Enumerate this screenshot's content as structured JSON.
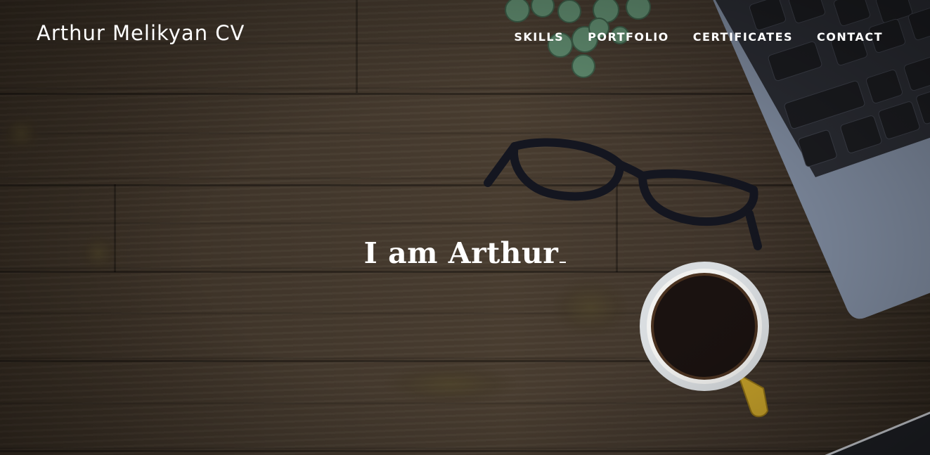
{
  "header": {
    "brand": "Arthur Melikyan CV",
    "nav": [
      {
        "label": "SKILLS"
      },
      {
        "label": "PORTFOLIO"
      },
      {
        "label": "CERTIFICATES"
      },
      {
        "label": "CONTACT"
      }
    ]
  },
  "hero": {
    "headline": "I am Arthur",
    "cursor": "_"
  },
  "colors": {
    "text": "#ffffff",
    "wood": "#43382c"
  },
  "decor": {
    "background": "wooden-desk-background",
    "items": [
      "plant-icon",
      "glasses-icon",
      "laptop-icon",
      "coffee-cup-icon"
    ]
  }
}
